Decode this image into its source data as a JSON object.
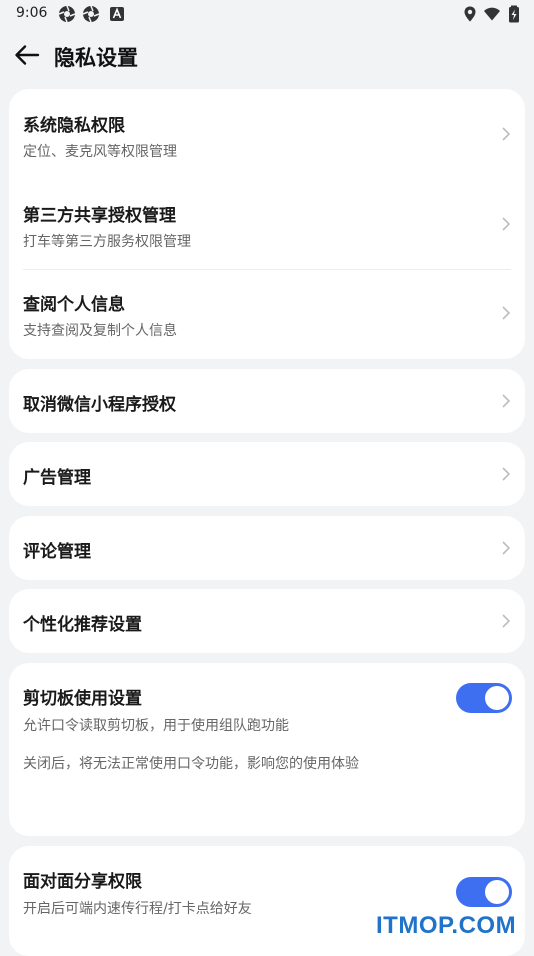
{
  "status_bar": {
    "time": "9:06",
    "left_icons": [
      "aperture-icon",
      "aperture-icon",
      "a-badge-icon"
    ],
    "right_icons": [
      "location-icon",
      "wifi-icon",
      "battery-icon"
    ]
  },
  "header": {
    "title": "隐私设置",
    "back_icon": "back-arrow-icon"
  },
  "cards": {
    "system": {
      "items": [
        {
          "title": "系统隐私权限",
          "subtitle": "定位、麦克风等权限管理"
        },
        {
          "title": "第三方共享授权管理",
          "subtitle": "打车等第三方服务权限管理"
        },
        {
          "title": "查阅个人信息",
          "subtitle": "支持查阅及复制个人信息"
        }
      ]
    },
    "wechat": {
      "title": "取消微信小程序授权"
    },
    "ads": {
      "title": "广告管理"
    },
    "comments": {
      "title": "评论管理"
    },
    "personalized": {
      "title": "个性化推荐设置"
    },
    "clipboard": {
      "title": "剪切板使用设置",
      "subtitle": "允许口令读取剪切板，用于使用组队跑功能",
      "note": "关闭后，将无法正常使用口令功能，影响您的使用体验",
      "enabled": true
    },
    "face_share": {
      "title": "面对面分享权限",
      "subtitle": "开启后可端内速传行程/打卡点给好友",
      "enabled": true
    }
  },
  "watermark": "ITMOP.COM",
  "colors": {
    "accent": "#3d6ff0",
    "background": "#f1f3f5",
    "card": "#ffffff",
    "watermark": "#1f73c9"
  }
}
